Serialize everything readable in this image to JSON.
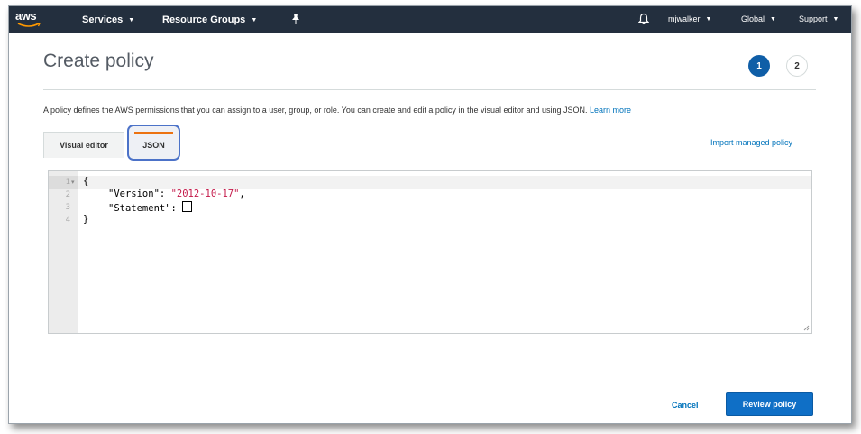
{
  "navbar": {
    "logo_text": "aws",
    "services_label": "Services",
    "resource_groups_label": "Resource Groups",
    "user_label": "mjwalker",
    "region_label": "Global",
    "support_label": "Support"
  },
  "header": {
    "title": "Create policy",
    "steps": [
      "1",
      "2"
    ]
  },
  "description": {
    "text": "A policy defines the AWS permissions that you can assign to a user, group, or role. You can create and edit a policy in the visual editor and using JSON.",
    "learn_more": "Learn more"
  },
  "tabs": {
    "visual_editor": "Visual editor",
    "json": "JSON"
  },
  "import_link": "Import managed policy",
  "editor": {
    "line_numbers": [
      "1",
      "2",
      "3",
      "4"
    ],
    "lines": {
      "open_brace": "{",
      "version_key": "\"Version\"",
      "version_value": "\"2012-10-17\"",
      "statement_key": "\"Statement\"",
      "close_brace": "}"
    }
  },
  "footer": {
    "cancel_label": "Cancel",
    "review_label": "Review policy"
  },
  "colors": {
    "navbar_bg": "#232f3e",
    "primary_button": "#0f6fc6",
    "link": "#0073bb",
    "tab_accent": "#ec7211",
    "highlight_outline": "#4c72c8",
    "string": "#c41a4a"
  }
}
